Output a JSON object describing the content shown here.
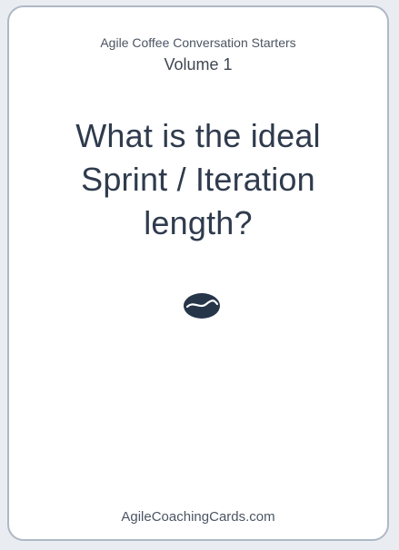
{
  "card": {
    "series_title": "Agile Coffee Conversation Starters",
    "volume": "Volume 1",
    "question": "What is the ideal Sprint / Iteration length?",
    "footer": "AgileCoachingCards.com",
    "icon": "coffee-bean-icon"
  },
  "colors": {
    "border": "#aeb8c6",
    "text": "#2f3b4d",
    "bean": "#273549",
    "background": "#ffffff"
  }
}
